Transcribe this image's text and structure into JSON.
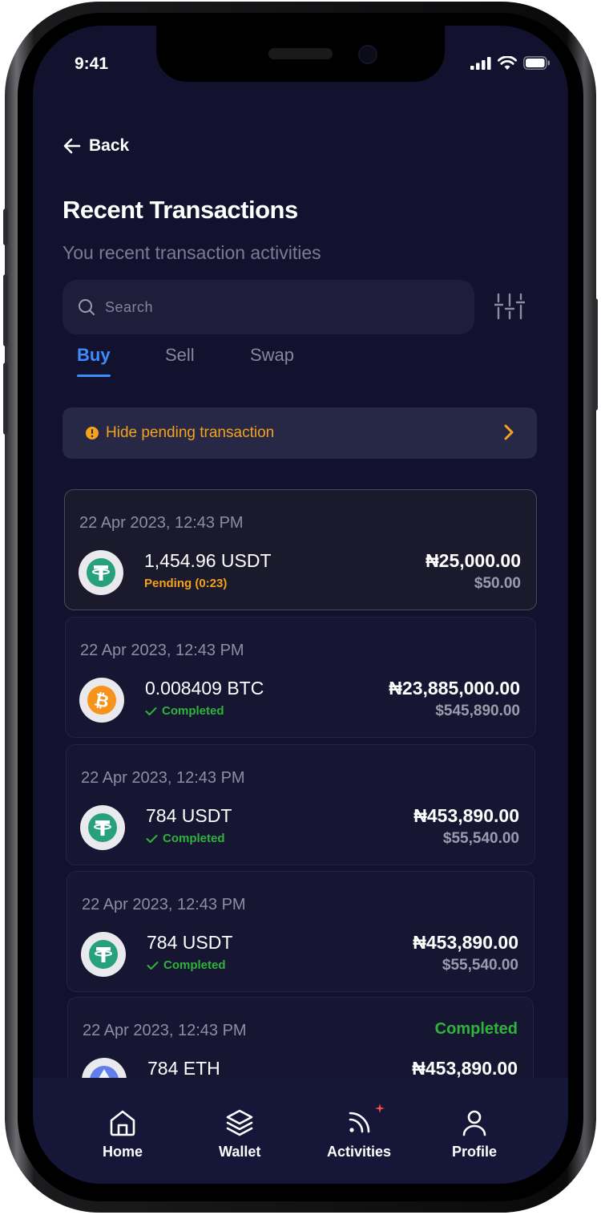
{
  "status_bar": {
    "time": "9:41"
  },
  "header": {
    "back_label": "Back",
    "title": "Recent Transactions",
    "subtitle": "You recent transaction activities"
  },
  "search": {
    "placeholder": "Search"
  },
  "tabs": [
    {
      "label": "Buy",
      "active": true
    },
    {
      "label": "Sell"
    },
    {
      "label": "Swap"
    }
  ],
  "pending_toggle": {
    "label": "Hide pending transaction"
  },
  "transactions": [
    {
      "date": "22 Apr 2023, 12:43 PM",
      "coin": "usdt-icon",
      "amount": "1,454.96 USDT",
      "status": "Pending (0:23)",
      "ngn": "₦25,000.00",
      "usd": "$50.00"
    },
    {
      "date": "22 Apr 2023, 12:43 PM",
      "coin": "btc-icon",
      "amount": "0.008409 BTC",
      "status": "Completed",
      "ngn": "₦23,885,000.00",
      "usd": "$545,890.00"
    },
    {
      "date": "22 Apr 2023, 12:43 PM",
      "coin": "usdt-icon",
      "amount": "784 USDT",
      "status": "Completed",
      "ngn": "₦453,890.00",
      "usd": "$55,540.00"
    },
    {
      "date": "22 Apr 2023, 12:43 PM",
      "coin": "usdt-icon",
      "amount": "784 USDT",
      "status": "Completed",
      "ngn": "₦453,890.00",
      "usd": "$55,540.00"
    },
    {
      "date": "22 Apr 2023, 12:43 PM",
      "coin": "eth-icon",
      "amount": "784 ETH",
      "status": "Completed",
      "ngn": "₦453,890.00"
    }
  ],
  "nav": [
    {
      "label": "Home"
    },
    {
      "label": "Wallet"
    },
    {
      "label": "Activities"
    },
    {
      "label": "Profile"
    }
  ],
  "colors": {
    "background": "#12122e",
    "accent": "#3d8cff",
    "pending": "#f4a11c",
    "completed": "#2fb33b",
    "usdt": "#26a17b",
    "btc": "#f7931a",
    "eth": "#627eea"
  }
}
